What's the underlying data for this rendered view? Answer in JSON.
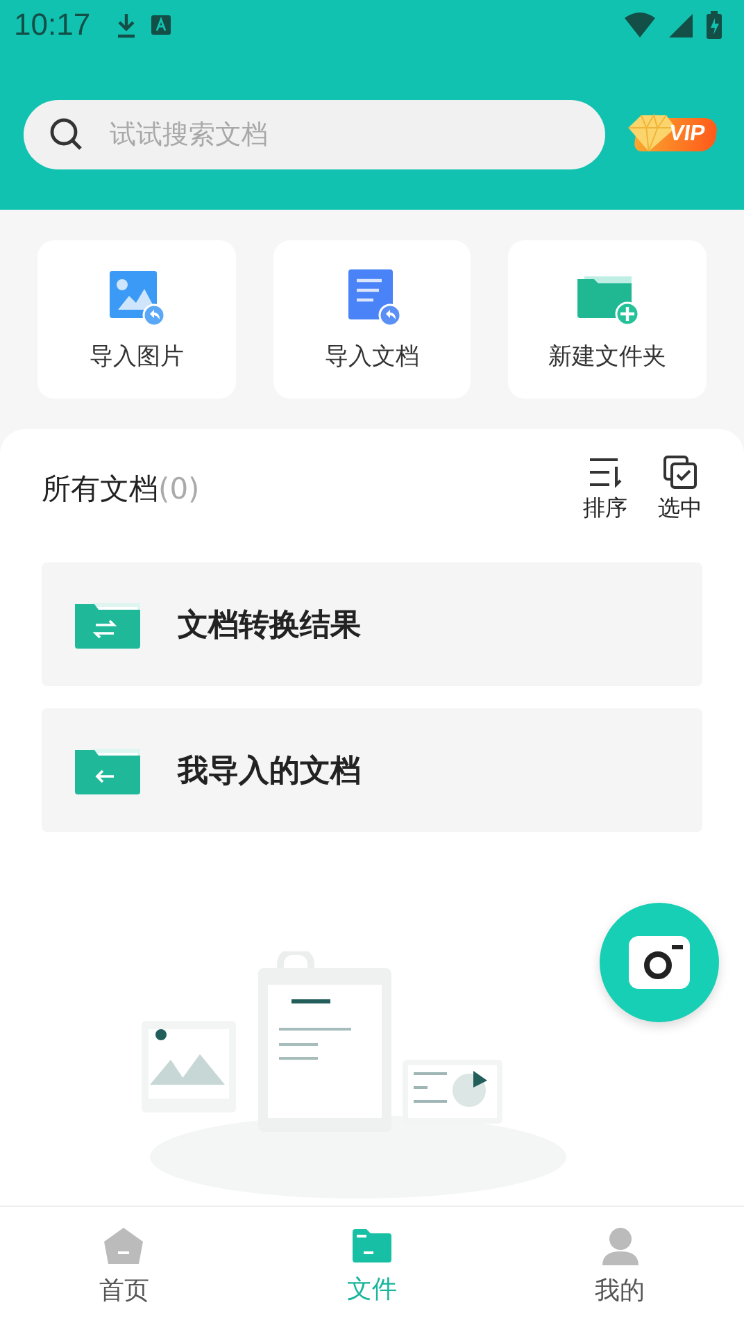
{
  "status_bar": {
    "time": "10:17"
  },
  "search": {
    "placeholder": "试试搜索文档"
  },
  "vip": {
    "label": "VIP"
  },
  "quick_actions": [
    {
      "kind": "image",
      "label": "导入图片"
    },
    {
      "kind": "document",
      "label": "导入文档"
    },
    {
      "kind": "folder",
      "label": "新建文件夹"
    }
  ],
  "section": {
    "title": "所有文档",
    "count": "(0)",
    "actions": [
      {
        "kind": "sort",
        "label": "排序"
      },
      {
        "kind": "select",
        "label": "选中"
      }
    ]
  },
  "folders": [
    {
      "kind": "convert",
      "name": "文档转换结果"
    },
    {
      "kind": "import",
      "name": "我导入的文档"
    }
  ],
  "bottom_nav": [
    {
      "kind": "home",
      "label": "首页",
      "selected": false
    },
    {
      "kind": "files",
      "label": "文件",
      "selected": true
    },
    {
      "kind": "profile",
      "label": "我的",
      "selected": false
    }
  ]
}
